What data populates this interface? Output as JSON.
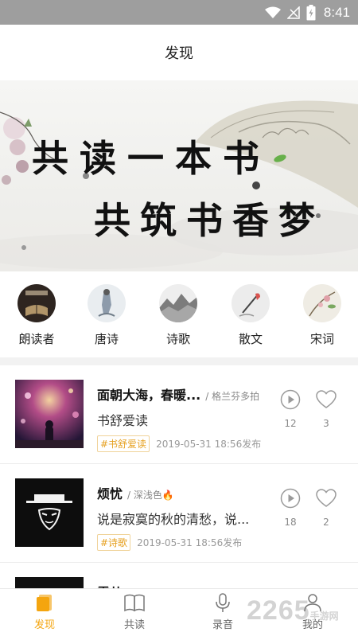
{
  "status_bar": {
    "time": "8:41",
    "icons": [
      "wifi-icon",
      "signal-icon",
      "battery-icon"
    ]
  },
  "header": {
    "title": "发现"
  },
  "banner": {
    "line1": "共读一本书",
    "line2": "共筑书香梦"
  },
  "categories": [
    {
      "label": "朗读者",
      "icon": "reader-icon"
    },
    {
      "label": "唐诗",
      "icon": "tang-poetry-icon"
    },
    {
      "label": "诗歌",
      "icon": "poetry-icon"
    },
    {
      "label": "散文",
      "icon": "prose-icon"
    },
    {
      "label": "宋词",
      "icon": "song-ci-icon"
    }
  ],
  "items": [
    {
      "title": "面朝大海，春暖...",
      "author": "/ 格兰芬多拍",
      "subtitle": "书舒爱读",
      "tag": "#书舒爱读",
      "date": "2019-05-31 18:56发布",
      "plays": "12",
      "likes": "3"
    },
    {
      "title": "烦忧",
      "author": "/ 深浅色🔥",
      "subtitle": "说是寂寞的秋的清愁，说...",
      "tag": "#诗歌",
      "date": "2019-05-31 18:56发布",
      "plays": "18",
      "likes": "2"
    },
    {
      "title": "雪儿",
      "author": "",
      "subtitle": "",
      "tag": "",
      "date": "",
      "plays": "",
      "likes": ""
    }
  ],
  "tabbar": [
    {
      "label": "发现",
      "icon": "discover-icon",
      "active": true
    },
    {
      "label": "共读",
      "icon": "book-icon",
      "active": false
    },
    {
      "label": "录音",
      "icon": "microphone-icon",
      "active": false
    },
    {
      "label": "我的",
      "icon": "profile-icon",
      "active": false
    }
  ],
  "watermark": {
    "text": "2265",
    "sub": "手游网"
  },
  "colors": {
    "accent": "#f4a50f",
    "tag": "#e6a020",
    "status_bar": "#9e9e9e"
  }
}
